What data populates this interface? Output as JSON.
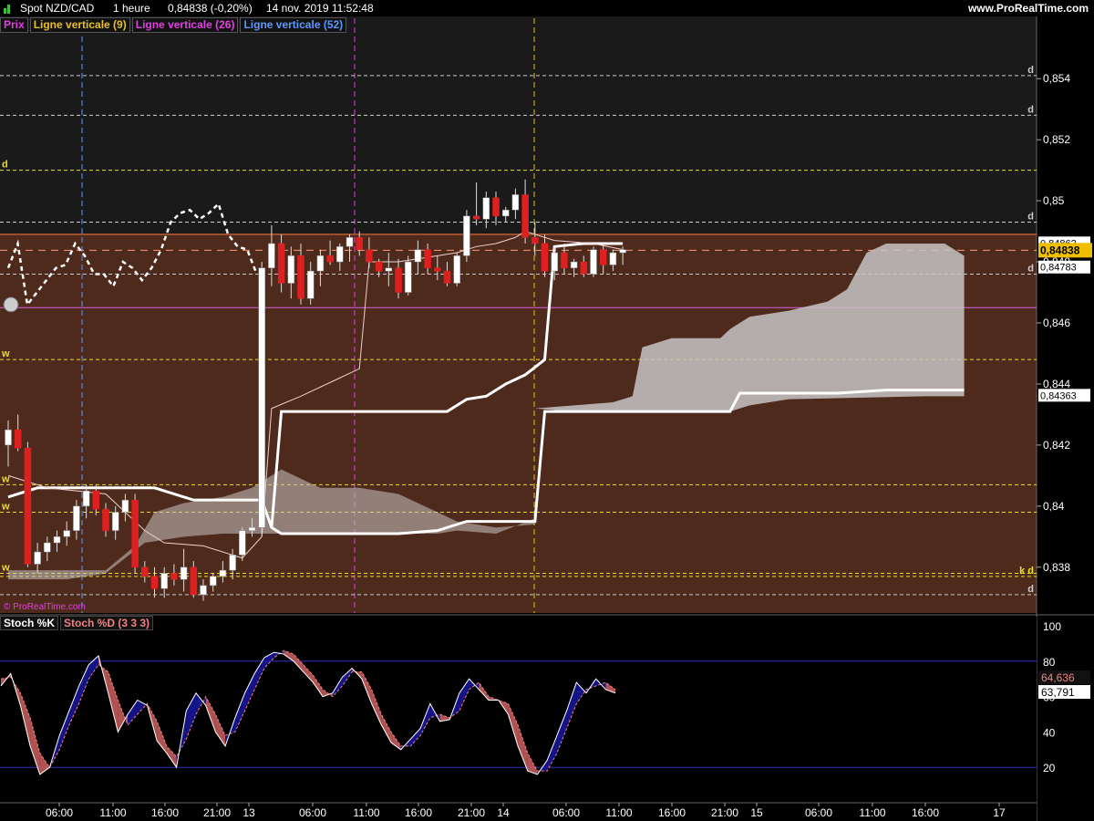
{
  "header": {
    "instrument": "Spot NZD/CAD",
    "timeframe": "1 heure",
    "last_change": "0,84838 (-0,20%)",
    "timestamp": "14 nov. 2019 11:52:48",
    "site": "www.ProRealTime.com"
  },
  "legend": [
    {
      "label": "Prix",
      "color": "#e040e0"
    },
    {
      "label": "Ligne verticale (9)",
      "color": "#e8c020"
    },
    {
      "label": "Ligne verticale (26)",
      "color": "#e040e0"
    },
    {
      "label": "Ligne verticale (52)",
      "color": "#5a9aff"
    }
  ],
  "copyright": "© ProRealTime.com",
  "stoch_legend": [
    {
      "label": "Stoch %K",
      "color": "#ffffff"
    },
    {
      "label": "Stoch %D (3 3 3)",
      "color": "#f08080"
    }
  ],
  "colors": {
    "price_bg": "#4e2a1c",
    "band_bg": "#1a1a1a",
    "stoch_bg": "#000000",
    "bull": "#ffffff",
    "bear": "#e02020",
    "cloud": "#c8c4c4",
    "level_yellow": "#e8e020",
    "level_white": "#cccccc",
    "stoch_k": "#ffffff",
    "stoch_d": "#f08080",
    "stoch_bull_fill": "#1818a0",
    "stoch_bear_fill": "#d06060"
  },
  "chart_data": [
    {
      "type": "candlestick",
      "title": "Spot NZD/CAD 1 heure",
      "ylim": [
        0.8365,
        0.8555
      ],
      "y_ticks": [
        "0,854",
        "0,852",
        "0,85",
        "0,848",
        "0,846",
        "0,844",
        "0,842",
        "0,84",
        "0,838"
      ],
      "x_ticks": [
        "06:00",
        "11:00",
        "16:00",
        "21:00",
        "13",
        "06:00",
        "11:00",
        "16:00",
        "21:00",
        "14",
        "06:00",
        "11:00",
        "16:00",
        "21:00",
        "15",
        "06:00",
        "11:00",
        "16:00",
        "17"
      ],
      "price_labels": [
        {
          "text": "0,84862",
          "value": 0.84862,
          "style": "plain"
        },
        {
          "text": "0,84838",
          "value": 0.84838,
          "style": "current"
        },
        {
          "text": "0,84783",
          "value": 0.84783,
          "style": "plain"
        },
        {
          "text": "0,84363",
          "value": 0.84363,
          "style": "plain"
        }
      ],
      "levels": [
        {
          "value": 0.8541,
          "tag": "d",
          "color": "white"
        },
        {
          "value": 0.8528,
          "tag": "d",
          "color": "white"
        },
        {
          "value": 0.851,
          "tag": "d",
          "color": "yellow"
        },
        {
          "value": 0.8493,
          "tag": "d",
          "color": "white"
        },
        {
          "value": 0.8489,
          "tag": "",
          "color": "orange"
        },
        {
          "value": 0.8476,
          "tag": "d",
          "color": "white"
        },
        {
          "value": 0.8465,
          "tag": "",
          "color": "magenta"
        },
        {
          "value": 0.8448,
          "tag": "w",
          "color": "yellow"
        },
        {
          "value": 0.8407,
          "tag": "w",
          "color": "yellow"
        },
        {
          "value": 0.8398,
          "tag": "w",
          "color": "yellow"
        },
        {
          "value": 0.8378,
          "tag": "w",
          "color": "yellow"
        },
        {
          "value": 0.8377,
          "tag": "k d",
          "color": "yellow"
        },
        {
          "value": 0.8371,
          "tag": "d",
          "color": "white"
        }
      ],
      "candles": [
        [
          0.842,
          0.8428,
          0.8413,
          0.8425
        ],
        [
          0.8425,
          0.843,
          0.8418,
          0.8419
        ],
        [
          0.8419,
          0.8421,
          0.838,
          0.8381
        ],
        [
          0.8381,
          0.8388,
          0.8378,
          0.8385
        ],
        [
          0.8385,
          0.839,
          0.8382,
          0.8388
        ],
        [
          0.8388,
          0.8392,
          0.8385,
          0.839
        ],
        [
          0.839,
          0.8395,
          0.8387,
          0.8392
        ],
        [
          0.8392,
          0.8402,
          0.8389,
          0.84
        ],
        [
          0.84,
          0.8407,
          0.8396,
          0.8405
        ],
        [
          0.8405,
          0.8407,
          0.8397,
          0.8399
        ],
        [
          0.8399,
          0.8401,
          0.839,
          0.8392
        ],
        [
          0.8392,
          0.84,
          0.8389,
          0.8398
        ],
        [
          0.8398,
          0.8404,
          0.8395,
          0.8402
        ],
        [
          0.8402,
          0.8404,
          0.8378,
          0.838
        ],
        [
          0.838,
          0.8382,
          0.8375,
          0.8377
        ],
        [
          0.8377,
          0.838,
          0.837,
          0.8373
        ],
        [
          0.8373,
          0.838,
          0.837,
          0.8378
        ],
        [
          0.8378,
          0.8381,
          0.8374,
          0.8376
        ],
        [
          0.8376,
          0.8386,
          0.8372,
          0.838
        ],
        [
          0.838,
          0.8382,
          0.837,
          0.8371
        ],
        [
          0.8371,
          0.8376,
          0.8369,
          0.8374
        ],
        [
          0.8374,
          0.8378,
          0.8372,
          0.8377
        ],
        [
          0.8377,
          0.8382,
          0.8375,
          0.8379
        ],
        [
          0.8379,
          0.8386,
          0.8376,
          0.8384
        ],
        [
          0.8384,
          0.8393,
          0.8382,
          0.8392
        ],
        [
          0.8392,
          0.8396,
          0.839,
          0.8393
        ],
        [
          0.8393,
          0.848,
          0.839,
          0.8478
        ],
        [
          0.8478,
          0.8492,
          0.8472,
          0.8486
        ],
        [
          0.8486,
          0.8489,
          0.847,
          0.8473
        ],
        [
          0.8473,
          0.8485,
          0.8468,
          0.8482
        ],
        [
          0.8482,
          0.8486,
          0.8466,
          0.8468
        ],
        [
          0.8468,
          0.848,
          0.8466,
          0.8477
        ],
        [
          0.8477,
          0.8484,
          0.8472,
          0.8482
        ],
        [
          0.8482,
          0.8487,
          0.8479,
          0.848
        ],
        [
          0.848,
          0.8486,
          0.8477,
          0.8485
        ],
        [
          0.8485,
          0.8489,
          0.848,
          0.8488
        ],
        [
          0.8488,
          0.849,
          0.8482,
          0.8484
        ],
        [
          0.8484,
          0.8488,
          0.8478,
          0.848
        ],
        [
          0.848,
          0.8481,
          0.8475,
          0.8477
        ],
        [
          0.8477,
          0.8483,
          0.8472,
          0.8478
        ],
        [
          0.8478,
          0.8481,
          0.8468,
          0.847
        ],
        [
          0.847,
          0.8482,
          0.8469,
          0.848
        ],
        [
          0.848,
          0.8487,
          0.8476,
          0.8484
        ],
        [
          0.8484,
          0.8486,
          0.8476,
          0.8478
        ],
        [
          0.8478,
          0.8482,
          0.8474,
          0.8477
        ],
        [
          0.8477,
          0.848,
          0.8472,
          0.8473
        ],
        [
          0.8473,
          0.8483,
          0.8472,
          0.8482
        ],
        [
          0.8482,
          0.8497,
          0.848,
          0.8495
        ],
        [
          0.8495,
          0.8506,
          0.8492,
          0.8494
        ],
        [
          0.8494,
          0.8503,
          0.8491,
          0.8501
        ],
        [
          0.8501,
          0.8503,
          0.8492,
          0.8495
        ],
        [
          0.8495,
          0.8498,
          0.8493,
          0.8497
        ],
        [
          0.8497,
          0.8504,
          0.8494,
          0.8502
        ],
        [
          0.8502,
          0.8507,
          0.8486,
          0.8488
        ],
        [
          0.8488,
          0.8493,
          0.8482,
          0.8486
        ],
        [
          0.8486,
          0.8489,
          0.8475,
          0.8477
        ],
        [
          0.8477,
          0.8485,
          0.8474,
          0.8483
        ],
        [
          0.8483,
          0.8486,
          0.8476,
          0.8478
        ],
        [
          0.8478,
          0.8481,
          0.8475,
          0.848
        ],
        [
          0.848,
          0.8482,
          0.8475,
          0.8476
        ],
        [
          0.8476,
          0.8485,
          0.8475,
          0.8484
        ],
        [
          0.8484,
          0.8486,
          0.8476,
          0.8479
        ],
        [
          0.8479,
          0.8484,
          0.8477,
          0.8483
        ],
        [
          0.8483,
          0.8485,
          0.8479,
          0.8484
        ]
      ],
      "ichimoku": {
        "tenkan": [
          0.8406,
          0.8406,
          0.8406,
          0.8406,
          0.8406,
          0.8406,
          0.8406,
          0.8406,
          0.8406,
          0.8406,
          0.8406,
          0.8406,
          0.8404,
          0.8402,
          0.8402,
          0.8402,
          0.8402,
          0.8402,
          0.8402,
          0.8402,
          0.8402,
          0.8402,
          0.8402,
          0.8402,
          0.8402,
          0.8402,
          0.8402,
          0.8435,
          0.8431,
          0.8431,
          0.8431,
          0.8431,
          0.8431,
          0.8431,
          0.8431,
          0.8431,
          0.8431,
          0.8431,
          0.8431,
          0.8431,
          0.8431,
          0.8433,
          0.8434,
          0.8434,
          0.8436,
          0.8438,
          0.844,
          0.8442,
          0.8444,
          0.8446,
          0.8447,
          0.8431,
          0.8431,
          0.8431,
          0.8432,
          0.8432,
          0.8432,
          0.8432,
          0.8432,
          0.8432,
          0.8432,
          0.8432,
          0.8433,
          0.8433
        ],
        "kijun_like_white": [
          0.8402,
          0.8402,
          0.8402,
          0.8402,
          0.8402,
          0.8402,
          0.8402,
          0.8402,
          0.8402,
          0.8402,
          0.8402,
          0.8402,
          0.8402,
          0.8402,
          0.8402,
          0.8402,
          0.8402,
          0.8402,
          0.8402,
          0.8402,
          0.8402,
          0.8402,
          0.8402,
          0.8402,
          0.8402,
          0.8402,
          0.8402,
          0.8391,
          0.8391,
          0.8391,
          0.8391,
          0.8391,
          0.8391,
          0.8391,
          0.8391,
          0.8391,
          0.8391,
          0.8391,
          0.8391,
          0.8391,
          0.8391,
          0.8393,
          0.8393,
          0.8393,
          0.8393,
          0.8393,
          0.8393,
          0.8393,
          0.8395,
          0.8396,
          0.8396,
          0.8396,
          0.8396,
          0.8396,
          0.8486,
          0.8486,
          0.8486,
          0.8486,
          0.8486,
          0.8486,
          0.8486,
          0.8486,
          0.8486,
          0.8486
        ]
      },
      "chikou_dashed": [
        0.8478,
        0.8486,
        0.8466,
        0.847,
        0.8474,
        0.8478,
        0.8479,
        0.8486,
        0.8482,
        0.8476,
        0.8476,
        0.8472,
        0.848,
        0.8478,
        0.8474,
        0.8478,
        0.8484,
        0.8493,
        0.8496,
        0.8497,
        0.8494,
        0.8496,
        0.8499,
        0.8489,
        0.8485,
        0.8484,
        0.8476
      ]
    },
    {
      "type": "line",
      "title": "Stoch %K / Stoch %D (3 3 3)",
      "ylim": [
        0,
        100
      ],
      "y_ticks": [
        "100",
        "80",
        "60",
        "40",
        "20"
      ],
      "levels": [
        80,
        20
      ],
      "value_labels": [
        {
          "text": "64,636",
          "series": "Stoch %D (3 3 3)"
        },
        {
          "text": "63,791",
          "series": "Stoch %K"
        }
      ],
      "series": [
        {
          "name": "Stoch %K",
          "values": [
            66,
            73,
            55,
            32,
            16,
            20,
            38,
            52,
            66,
            78,
            83,
            62,
            40,
            50,
            58,
            55,
            35,
            28,
            20,
            52,
            62,
            55,
            40,
            32,
            48,
            62,
            73,
            82,
            85,
            84,
            80,
            74,
            68,
            60,
            62,
            71,
            76,
            70,
            56,
            44,
            34,
            30,
            36,
            42,
            56,
            46,
            47,
            62,
            70,
            64,
            58,
            58,
            50,
            32,
            18,
            16,
            24,
            38,
            52,
            68,
            62,
            70,
            64,
            62
          ],
          "d_values": [
            70,
            71,
            62,
            48,
            28,
            20,
            30,
            44,
            56,
            70,
            78,
            74,
            58,
            44,
            50,
            56,
            46,
            32,
            26,
            36,
            50,
            60,
            50,
            38,
            40,
            52,
            64,
            76,
            82,
            86,
            84,
            78,
            72,
            64,
            60,
            66,
            74,
            74,
            64,
            50,
            40,
            32,
            32,
            38,
            48,
            50,
            48,
            52,
            64,
            68,
            60,
            58,
            56,
            44,
            28,
            18,
            18,
            28,
            42,
            56,
            64,
            66,
            68,
            64
          ]
        }
      ]
    }
  ]
}
